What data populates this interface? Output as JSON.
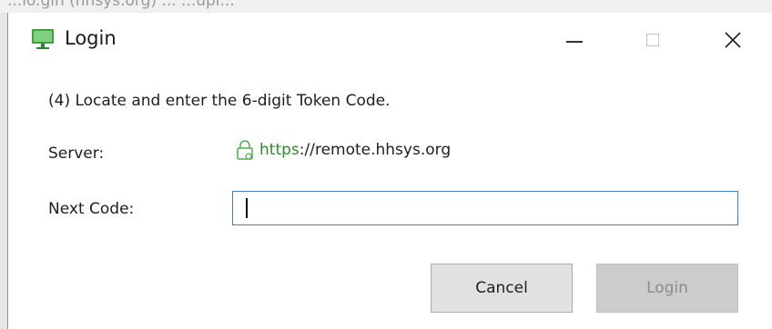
{
  "background": {
    "partial_text": "...lo.gin (hhsys.org) ... ...upl..."
  },
  "window": {
    "title": "Login",
    "app_icon": "monitor-icon",
    "controls": {
      "minimize": "minimize-icon",
      "maximize": "maximize-icon",
      "close": "close-icon",
      "close_glyph": "✕"
    }
  },
  "form": {
    "instruction": "(4) Locate and enter the 6-digit Token Code.",
    "server_label": "Server:",
    "server_url_scheme": "https",
    "server_url_rest": "://remote.hhsys.org",
    "server_icon": "lock-icon",
    "next_code_label": "Next Code:",
    "next_code_value": ""
  },
  "buttons": {
    "cancel": "Cancel",
    "login": "Login"
  },
  "colors": {
    "accent_border": "#3f7fbf",
    "url_green": "#2e8b2e",
    "disabled_text": "#8c8c8c"
  }
}
